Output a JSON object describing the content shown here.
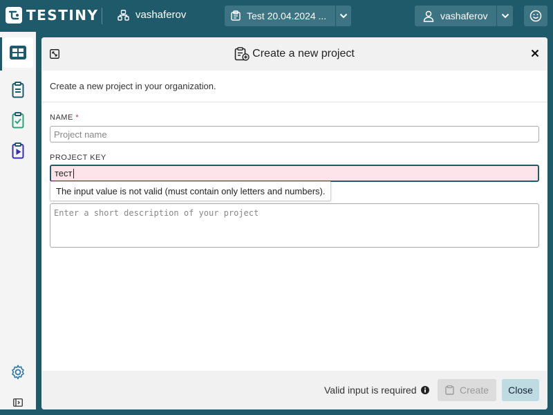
{
  "brand": {
    "name": "TESTINY"
  },
  "topbar": {
    "org_name": "vashaferov",
    "project_selector": "Test 20.04.2024 ...",
    "user_name": "vashaferov"
  },
  "sidebar": {
    "items": [
      {
        "name": "dashboard",
        "active": true
      },
      {
        "name": "test-cases",
        "active": false
      },
      {
        "name": "test-runs",
        "active": false
      },
      {
        "name": "automation",
        "active": false
      }
    ]
  },
  "modal": {
    "title": "Create a new project",
    "intro": "Create a new project in your organization.",
    "name_field": {
      "label": "NAME",
      "required_mark": "*",
      "placeholder": "Project name",
      "value": ""
    },
    "key_field": {
      "label": "PROJECT KEY",
      "value": "тест",
      "error": "The input value is not valid (must contain only letters and numbers)."
    },
    "description_field": {
      "placeholder": "Enter a short description of your project"
    },
    "footer": {
      "status": "Valid input is required",
      "create_label": "Create",
      "close_label": "Close"
    }
  },
  "colors": {
    "primary": "#1f5a6a",
    "error_bg": "#fce4ea",
    "required": "#c0304a"
  }
}
